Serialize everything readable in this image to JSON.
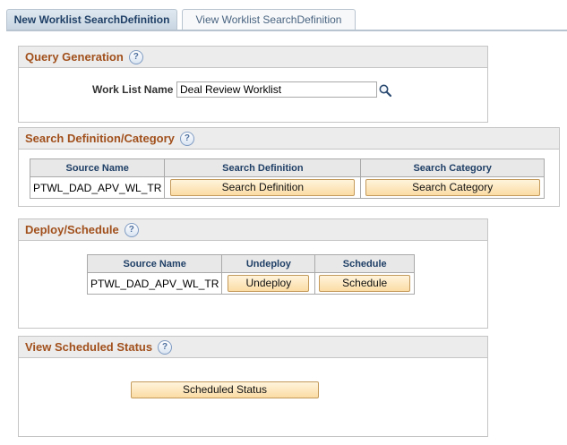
{
  "tabs": [
    {
      "label": "New Worklist SearchDefinition",
      "active": true
    },
    {
      "label": "View Worklist SearchDefinition",
      "active": false
    }
  ],
  "query_generation": {
    "title": "Query Generation",
    "help_label": "?",
    "work_list_name_label": "Work List Name",
    "work_list_name_value": "Deal Review Worklist"
  },
  "search_definition_category": {
    "title": "Search Definition/Category",
    "help_label": "?",
    "columns": [
      "Source Name",
      "Search Definition",
      "Search Category"
    ],
    "row": {
      "source_name": "PTWL_DAD_APV_WL_TR",
      "search_definition_button": "Search Definition",
      "search_category_button": "Search Category"
    }
  },
  "deploy_schedule": {
    "title": "Deploy/Schedule",
    "help_label": "?",
    "columns": [
      "Source Name",
      "Undeploy",
      "Schedule"
    ],
    "row": {
      "source_name": "PTWL_DAD_APV_WL_TR",
      "undeploy_button": "Undeploy",
      "schedule_button": "Schedule"
    }
  },
  "view_scheduled_status": {
    "title": "View Scheduled Status",
    "help_label": "?",
    "scheduled_status_button": "Scheduled Status"
  },
  "colors": {
    "section_title": "#a1501c",
    "grid_header_text": "#1f3f66",
    "button_fill": "#fbdca4",
    "button_border": "#c49a5b"
  },
  "icons": {
    "help": "help-icon",
    "lookup": "magnifier-icon"
  }
}
